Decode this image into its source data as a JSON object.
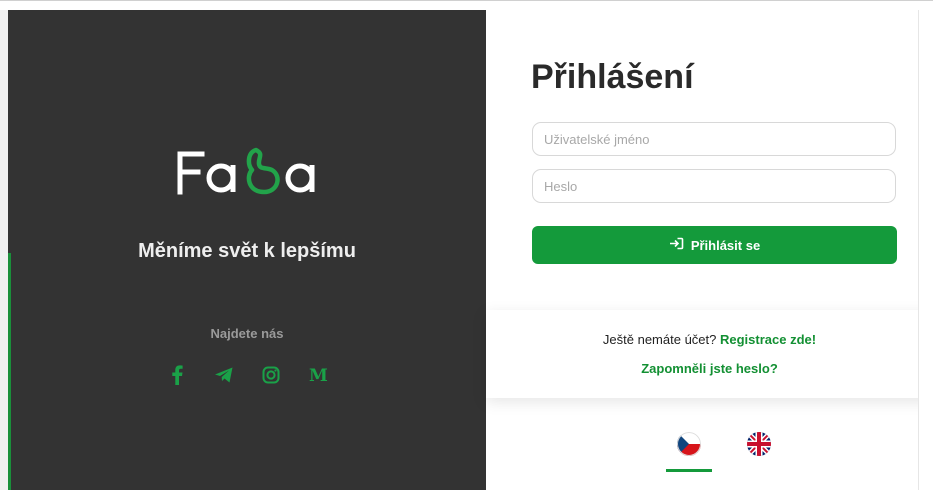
{
  "brand": {
    "logo_text": "Faba",
    "tagline": "Měníme svět k lepšímu",
    "find_us": "Najdete nás",
    "socials": [
      "facebook-icon",
      "telegram-icon",
      "instagram-icon",
      "medium-icon"
    ]
  },
  "login": {
    "title": "Přihlášení",
    "username_placeholder": "Uživatelské jméno",
    "username_value": "",
    "password_placeholder": "Heslo",
    "password_value": "",
    "submit_label": "Přihlásit se",
    "submit_icon": "sign-in-icon"
  },
  "signup": {
    "prompt": "Ještě nemáte účet?",
    "register_link": "Registrace zde!",
    "forgot_link": "Zapomněli jste heslo?"
  },
  "languages": [
    {
      "code": "cs",
      "flag": "czech-flag-icon",
      "selected": true
    },
    {
      "code": "en",
      "flag": "uk-flag-icon",
      "selected": false
    }
  ],
  "colors": {
    "accent": "#149a3b",
    "panel": "#333333",
    "link": "#139033"
  }
}
